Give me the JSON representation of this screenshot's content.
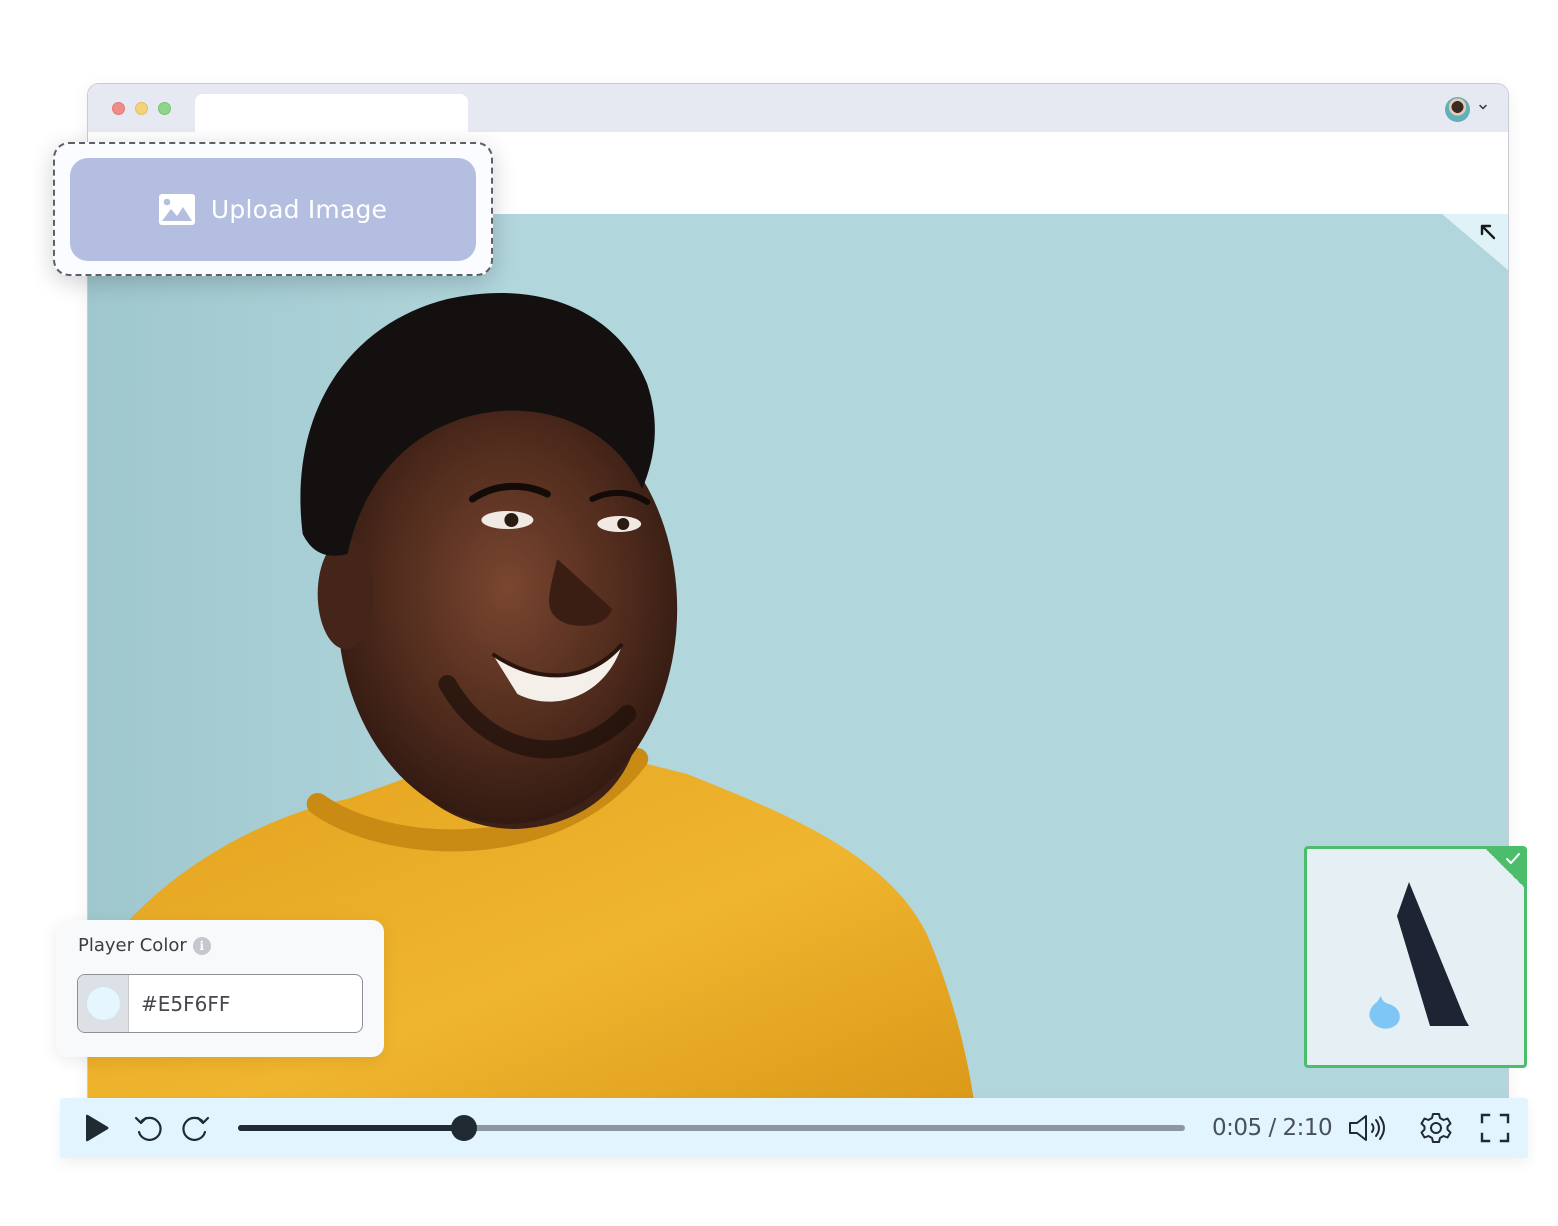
{
  "browser": {
    "window_controls": [
      "close",
      "minimize",
      "maximize"
    ],
    "tab_title": "",
    "profile": {
      "icon": "avatar",
      "menu_icon": "chevron-down-icon"
    }
  },
  "upload": {
    "label": "Upload Image",
    "icon": "image-icon"
  },
  "stage": {
    "background_color": "#B1D6DC",
    "corner_icon": "collapse-arrow-icon",
    "subject": "Smiling man in mustard-yellow sweater"
  },
  "player_color": {
    "title": "Player Color",
    "info_icon": "info-icon",
    "value": "#E5F6FF",
    "swatch_color": "#E5F6FF"
  },
  "logo_card": {
    "selected": true,
    "check_icon": "check-icon",
    "border_color": "#4CBD6A"
  },
  "player": {
    "play_icon": "play-icon",
    "rewind_icon": "rewind-icon",
    "forward_icon": "forward-icon",
    "current_time": "0:05",
    "duration": "2:10",
    "time_display": "0:05 / 2:10",
    "progress_fraction": 0.239,
    "volume_icon": "volume-icon",
    "settings_icon": "gear-icon",
    "fullscreen_icon": "fullscreen-icon",
    "bar_color": "#E2F4FD"
  }
}
